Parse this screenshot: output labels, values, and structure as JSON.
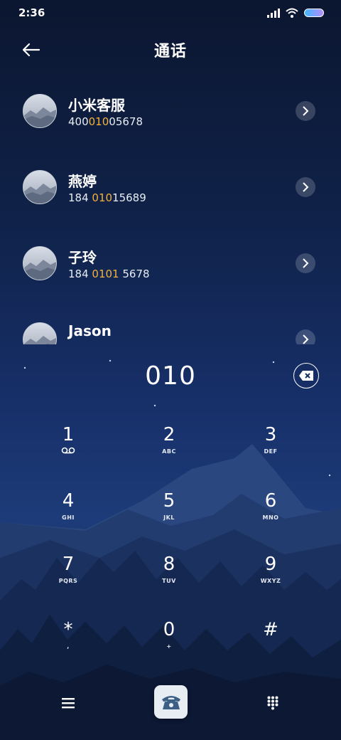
{
  "status_bar": {
    "time": "2:36"
  },
  "header": {
    "title": "通话"
  },
  "contacts": [
    {
      "name": "小米客服",
      "number_pre": "400",
      "number_match": "010",
      "number_post": "05678"
    },
    {
      "name": "燕婷",
      "number_pre": "184 ",
      "number_match": "010",
      "number_post": "15689"
    },
    {
      "name": "子玲",
      "number_pre": "184 ",
      "number_match": "0101",
      "number_post": " 5678"
    },
    {
      "name": "Jason",
      "number_pre": "",
      "number_match": "",
      "number_post": ""
    }
  ],
  "dialer": {
    "input": "010"
  },
  "keypad": [
    {
      "digit": "1",
      "letters": ""
    },
    {
      "digit": "2",
      "letters": "ABC"
    },
    {
      "digit": "3",
      "letters": "DEF"
    },
    {
      "digit": "4",
      "letters": "GHI"
    },
    {
      "digit": "5",
      "letters": "JKL"
    },
    {
      "digit": "6",
      "letters": "MNO"
    },
    {
      "digit": "7",
      "letters": "PQRS"
    },
    {
      "digit": "8",
      "letters": "TUV"
    },
    {
      "digit": "9",
      "letters": "WXYZ"
    },
    {
      "digit": "*",
      "letters": ","
    },
    {
      "digit": "0",
      "letters": "+"
    },
    {
      "digit": "#",
      "letters": ""
    }
  ],
  "icons": {
    "back": "arrow-left-icon",
    "voicemail": "voicemail-icon",
    "delete": "backspace-icon",
    "menu": "menu-icon",
    "call": "phone-icon",
    "dialpad": "dialpad-icon"
  },
  "colors": {
    "highlight": "#f3b23a"
  }
}
